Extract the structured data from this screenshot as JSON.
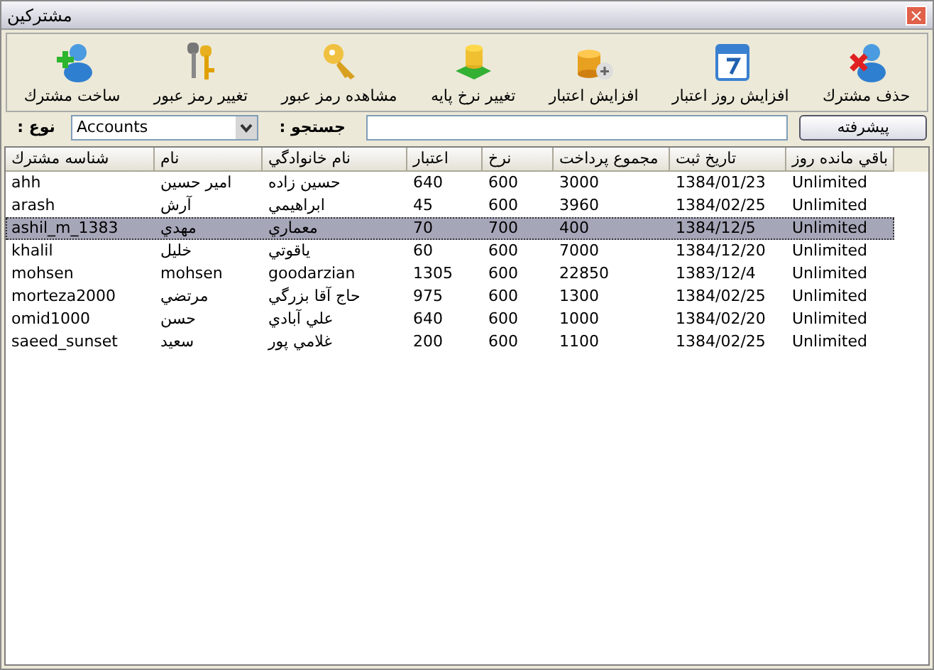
{
  "window": {
    "title": "مشتركين",
    "close": "×"
  },
  "toolbar": [
    {
      "label": "حذف مشترك",
      "kind": "user-delete"
    },
    {
      "label": "افزايش روز اعتبار",
      "kind": "calendar"
    },
    {
      "label": "افزايش اعتبار",
      "kind": "coins-add"
    },
    {
      "label": "تغيير نرخ پايه",
      "kind": "coins-green"
    },
    {
      "label": "مشاهده رمز عبور",
      "kind": "key"
    },
    {
      "label": "تغيير رمز عبور",
      "kind": "keys"
    },
    {
      "label": "ساخت مشترك",
      "kind": "user-add"
    }
  ],
  "filter": {
    "type_label": ": نوع",
    "type_value": "Accounts",
    "search_label": ": جستجو",
    "advanced_button": "پيشرفته"
  },
  "table": {
    "columns": [
      "باقي مانده روز",
      "تاريخ ثبت",
      "مجموع پرداخت",
      "نرخ",
      "اعتبار",
      "نام خانوادگي",
      "نام",
      "شناسه مشترك"
    ],
    "rows": [
      {
        "cells": [
          "Unlimited",
          "1384/01/23",
          "3000",
          "600",
          "640",
          "حسين زاده",
          "امير حسين",
          "ahh"
        ],
        "selected": false
      },
      {
        "cells": [
          "Unlimited",
          "1384/02/25",
          "3960",
          "600",
          "45",
          "ابراهيمي",
          "آرش",
          "arash"
        ],
        "selected": false
      },
      {
        "cells": [
          "Unlimited",
          "1384/12/5",
          "400",
          "700",
          "70",
          "معماري",
          "مهدي",
          "ashil_m_1383"
        ],
        "selected": true
      },
      {
        "cells": [
          "Unlimited",
          "1384/12/20",
          "7000",
          "600",
          "60",
          "ياقوتي",
          "خليل",
          "khalil"
        ],
        "selected": false
      },
      {
        "cells": [
          "Unlimited",
          "1383/12/4",
          "22850",
          "600",
          "1305",
          "goodarzian",
          "mohsen",
          "mohsen"
        ],
        "selected": false
      },
      {
        "cells": [
          "Unlimited",
          "1384/02/25",
          "1300",
          "600",
          "975",
          "حاج آقا بزرگي",
          "مرتضي",
          "morteza2000"
        ],
        "selected": false
      },
      {
        "cells": [
          "Unlimited",
          "1384/02/20",
          "1000",
          "600",
          "640",
          "علي آبادي",
          "حسن",
          "omid1000"
        ],
        "selected": false
      },
      {
        "cells": [
          "Unlimited",
          "1384/02/25",
          "1100",
          "600",
          "200",
          "غلامي پور",
          "سعيد",
          "saeed_sunset"
        ],
        "selected": false
      }
    ]
  }
}
